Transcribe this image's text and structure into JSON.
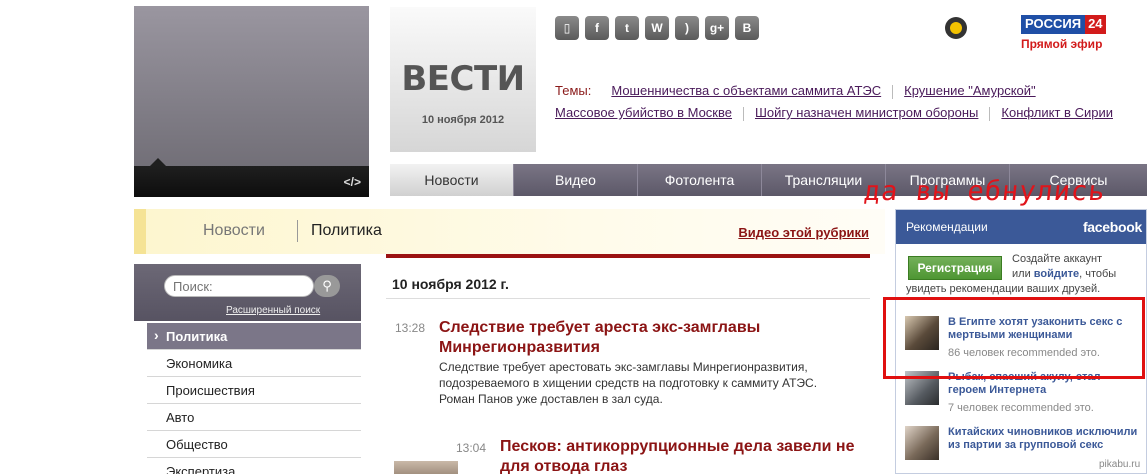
{
  "logo": {
    "title": "ВЕСТИ",
    "date": "10 ноября 2012"
  },
  "video_box": {
    "embed_label": "</>"
  },
  "social_icons": [
    {
      "name": "mobile-icon",
      "glyph": "▯"
    },
    {
      "name": "facebook-icon",
      "glyph": "f"
    },
    {
      "name": "twitter-icon",
      "glyph": "t"
    },
    {
      "name": "wap-icon",
      "glyph": "W"
    },
    {
      "name": "rss-icon",
      "glyph": ")"
    },
    {
      "name": "google-plus-icon",
      "glyph": "g+"
    },
    {
      "name": "vkontakte-icon",
      "glyph": "B"
    }
  ],
  "channel": {
    "name": "РОССИЯ",
    "number": "24",
    "live": "Прямой эфир"
  },
  "topics": {
    "label": "Темы:",
    "items": [
      "Мошенничества с объектами саммита АТЭС",
      "Крушение \"Амурской\"",
      "Массовое убийство в Москве",
      "Шойгу назначен министром обороны",
      "Конфликт в Сирии"
    ]
  },
  "nav": [
    "Новости",
    "Видео",
    "Фотолента",
    "Трансляции",
    "Программы",
    "Сервисы"
  ],
  "overlay_text": "да вы ебнулись",
  "breadcrumb": {
    "section": "Новости",
    "current": "Политика",
    "video_link": "Видео этой рубрики"
  },
  "search": {
    "placeholder": "Поиск:",
    "advanced": "Расширенный поиск"
  },
  "menu": [
    "Политика",
    "Экономика",
    "Происшествия",
    "Авто",
    "Общество",
    "Экспертиза"
  ],
  "date_heading": "10 ноября 2012 г.",
  "news": [
    {
      "time": "13:28",
      "title_line1": "Следствие требует ареста экс-замглавы",
      "title_line2": "Минрегионразвития",
      "text_line1": "Следствие требует арестовать экс-замглавы Минрегионразвития,",
      "text_line2": "подозреваемого в хищении средств на подготовку к саммиту АТЭС.",
      "text_line3": "Роман Панов уже доставлен в зал суда."
    },
    {
      "time": "13:04",
      "title_line1": "Песков: антикоррупционные дела завели не",
      "title_line2": "для отвода глаз"
    }
  ],
  "facebook": {
    "header": "Рекомендации",
    "logo": "facebook",
    "register": "Регистрация",
    "note_line1": "Создайте аккаунт",
    "note_line2a": "или ",
    "note_login": "войдите",
    "note_line2b": ", чтобы",
    "note_line3": "увидеть рекомендации ваших друзей.",
    "recs": [
      {
        "title": "В Египте хотят узаконить секс с мертвыми женщинами",
        "count": "86 человек recommended это."
      },
      {
        "title": "Рыбак, спасший акулу, стал героем Интернета",
        "count": "7 человек recommended это."
      },
      {
        "title": "Китайских чиновников исключили из партии за групповой секс",
        "count": ""
      }
    ]
  },
  "watermark": "pikabu.ru",
  "colors": {
    "accent_red": "#8b1414",
    "nav_bg": "#6a6676",
    "fb_blue": "#3b5998",
    "highlight": "#e01010"
  }
}
